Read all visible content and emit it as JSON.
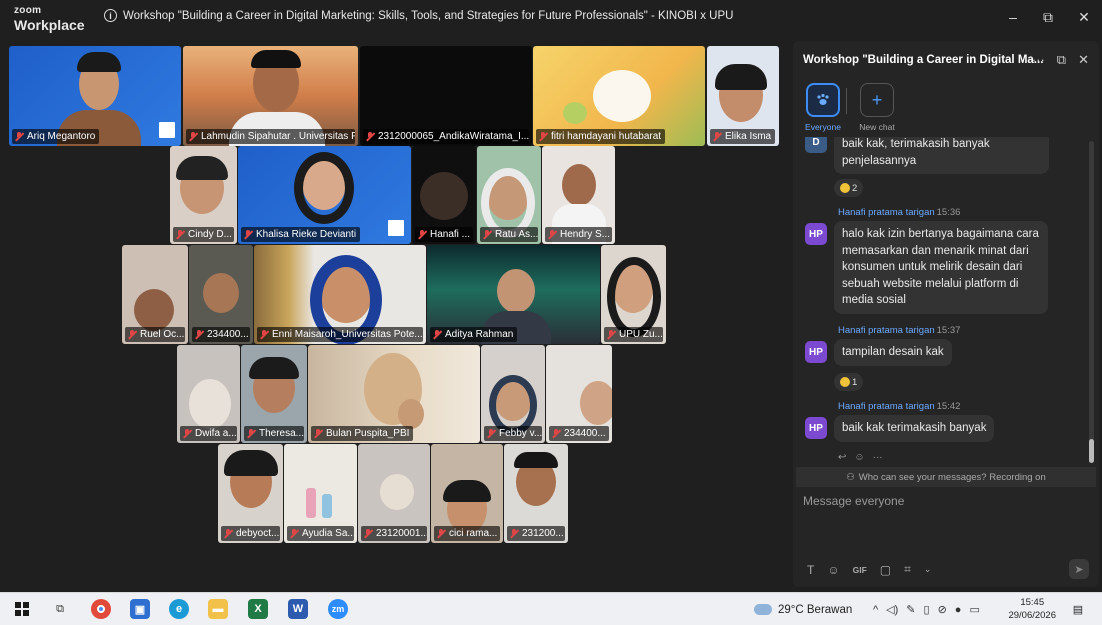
{
  "titlebar": {
    "brand_top": "zoom",
    "brand_bottom": "Workplace",
    "title": "Workshop \"Building a Career in Digital Marketing: Skills, Tools,  and Strategies for Future Professionals\" - KINOBI x UPU",
    "minimize": "–",
    "maximize": "⧉",
    "close": "✕"
  },
  "participants": [
    "Ariq Megantoro",
    "Lahmudin Sipahutar . Universitas P...",
    "2312000065_AndikaWiratama_I...",
    "fitri hamdayani hutabarat",
    "Elika  Isma",
    "Cindy D...",
    "Khalisa Rieke Devianti",
    "Hanafi ...",
    "Ratu As...",
    "Hendry S...",
    "Ruel Oc...",
    "234400...",
    "Enni Maisaroh_Universitas Pote...",
    "Aditya Rahman",
    "UPU Zu...",
    "Dwifa a...",
    "Theresa...",
    "Bulan Puspita_PBI",
    "Febby v...",
    "234400...",
    "debyoct...",
    "Ayudia Sa...",
    "23120001...",
    "cici rama...",
    "231200..."
  ],
  "chat": {
    "title": "Workshop \"Building a Career in Digital Ma...",
    "more": "···",
    "popout": "⧉",
    "close": "✕",
    "tab_everyone": "Everyone",
    "tab_new": "New chat",
    "avatar_d": "D",
    "msg0": "baik kak, terimakasih banyak penjelasannya",
    "react0": "2",
    "sender1": "Hanafi pratama tarigan",
    "time1": "15:36",
    "avatar_hp": "HP",
    "msg1": "halo kak izin bertanya bagaimana cara memasarkan dan menarik minat dari konsumen untuk melirik desain dari sebuah website melalui platform di media sosial",
    "sender2": "Hanafi pratama tarigan",
    "time2": "15:37",
    "msg2": "tampilan desain kak",
    "react2": "1",
    "sender3": "Hanafi pratama tarigan",
    "time3": "15:42",
    "msg3": "baik kak terimakasih banyak",
    "notice": "Who can see your messages? Recording on",
    "placeholder": "Message everyone",
    "gif": "GIF"
  },
  "taskbar": {
    "weather": "29°C  Berawan",
    "time": "15:45",
    "date": "29/06/2026"
  },
  "colors": {
    "accent": "#3d8df5",
    "active_speaker": "#3ccf6e",
    "muted": "#e04646",
    "avatar_hp": "#7b4ad1",
    "avatar_d": "#3b5b87"
  }
}
